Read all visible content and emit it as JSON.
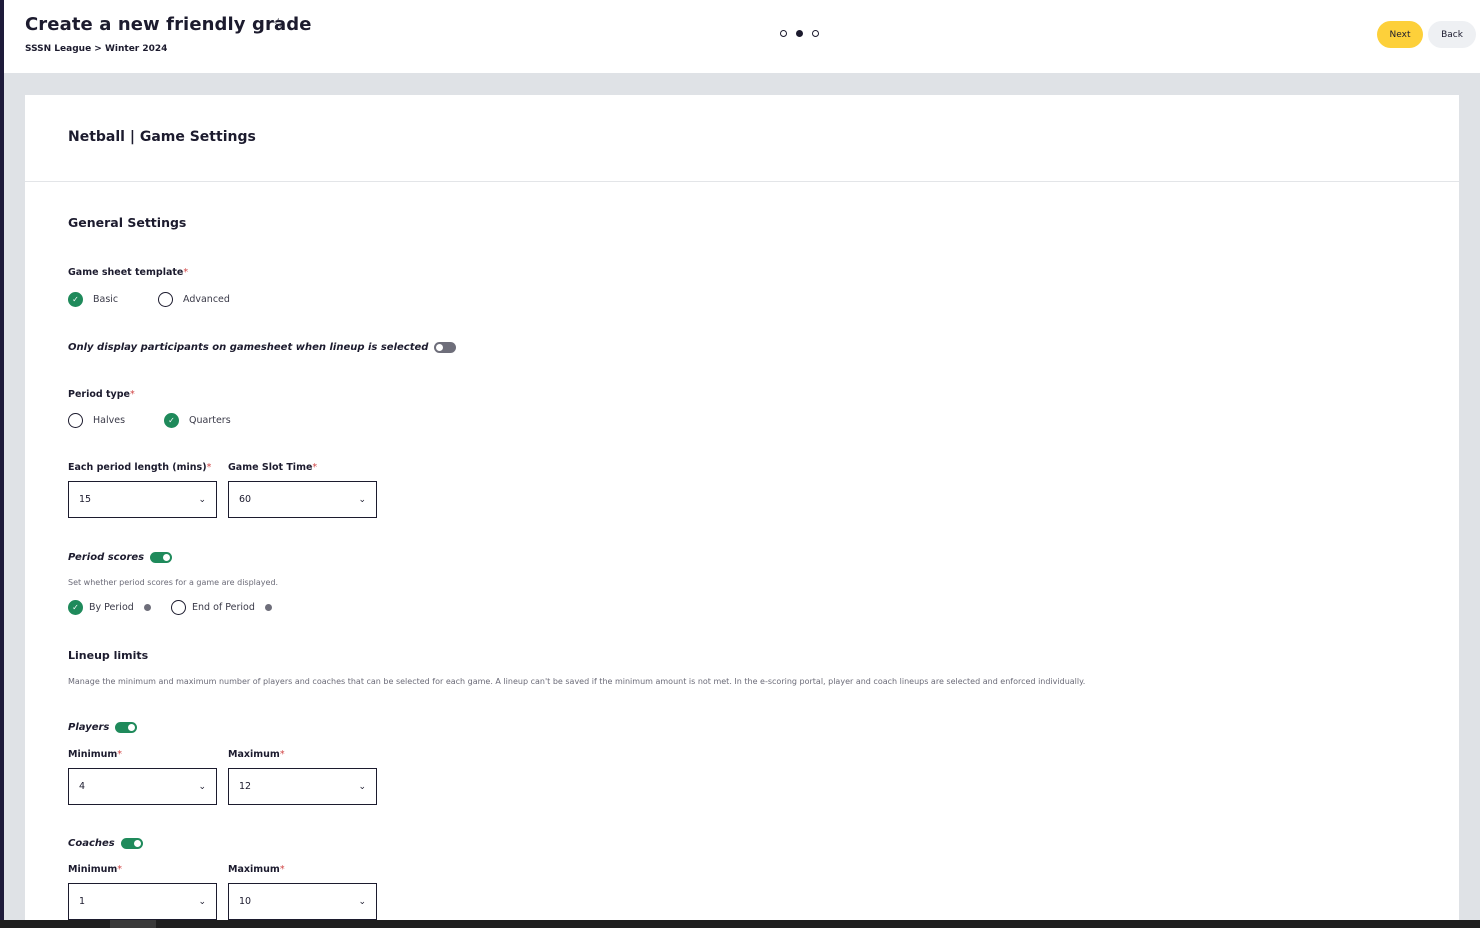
{
  "header": {
    "title": "Create a new friendly grade",
    "breadcrumb": "SSSN League > Winter 2024",
    "next_label": "Next",
    "back_label": "Back"
  },
  "card": {
    "title": "Netball | Game Settings"
  },
  "general": {
    "title": "General Settings",
    "template_label": "Game sheet template",
    "template_options": [
      {
        "label": "Basic",
        "checked": true
      },
      {
        "label": "Advanced",
        "checked": false
      }
    ],
    "display_participants_label": "Only display participants on gamesheet when lineup is selected",
    "display_participants_on": false,
    "period_type_label": "Period type",
    "period_type_options": [
      {
        "label": "Halves",
        "checked": false
      },
      {
        "label": "Quarters",
        "checked": true
      }
    ],
    "period_length_label": "Each period length (mins)",
    "period_length_value": "15",
    "slot_time_label": "Game Slot Time",
    "slot_time_value": "60",
    "period_scores_label": "Period scores",
    "period_scores_on": true,
    "period_scores_desc": "Set whether period scores for a game are displayed.",
    "period_scores_options": [
      {
        "label": "By Period",
        "checked": true
      },
      {
        "label": "End of Period",
        "checked": false
      }
    ]
  },
  "lineup": {
    "title": "Lineup limits",
    "desc": "Manage the minimum and maximum number of players and coaches that can be selected for each game. A lineup can't be saved if the minimum amount is not met. In the e-scoring portal, player and coach lineups are selected and enforced individually.",
    "players": {
      "label": "Players",
      "on": true,
      "min_label": "Minimum",
      "min_value": "4",
      "max_label": "Maximum",
      "max_value": "12"
    },
    "coaches": {
      "label": "Coaches",
      "on": true,
      "min_label": "Minimum",
      "min_value": "1",
      "max_label": "Maximum",
      "max_value": "10"
    }
  },
  "required_mark": "*",
  "icons": {
    "star": "☆",
    "check": "✓",
    "chevron": "⌄"
  },
  "colors": {
    "accent_green": "#1f8a5b",
    "next_button": "#fdd03a",
    "dark_text": "#1c1b2e"
  }
}
